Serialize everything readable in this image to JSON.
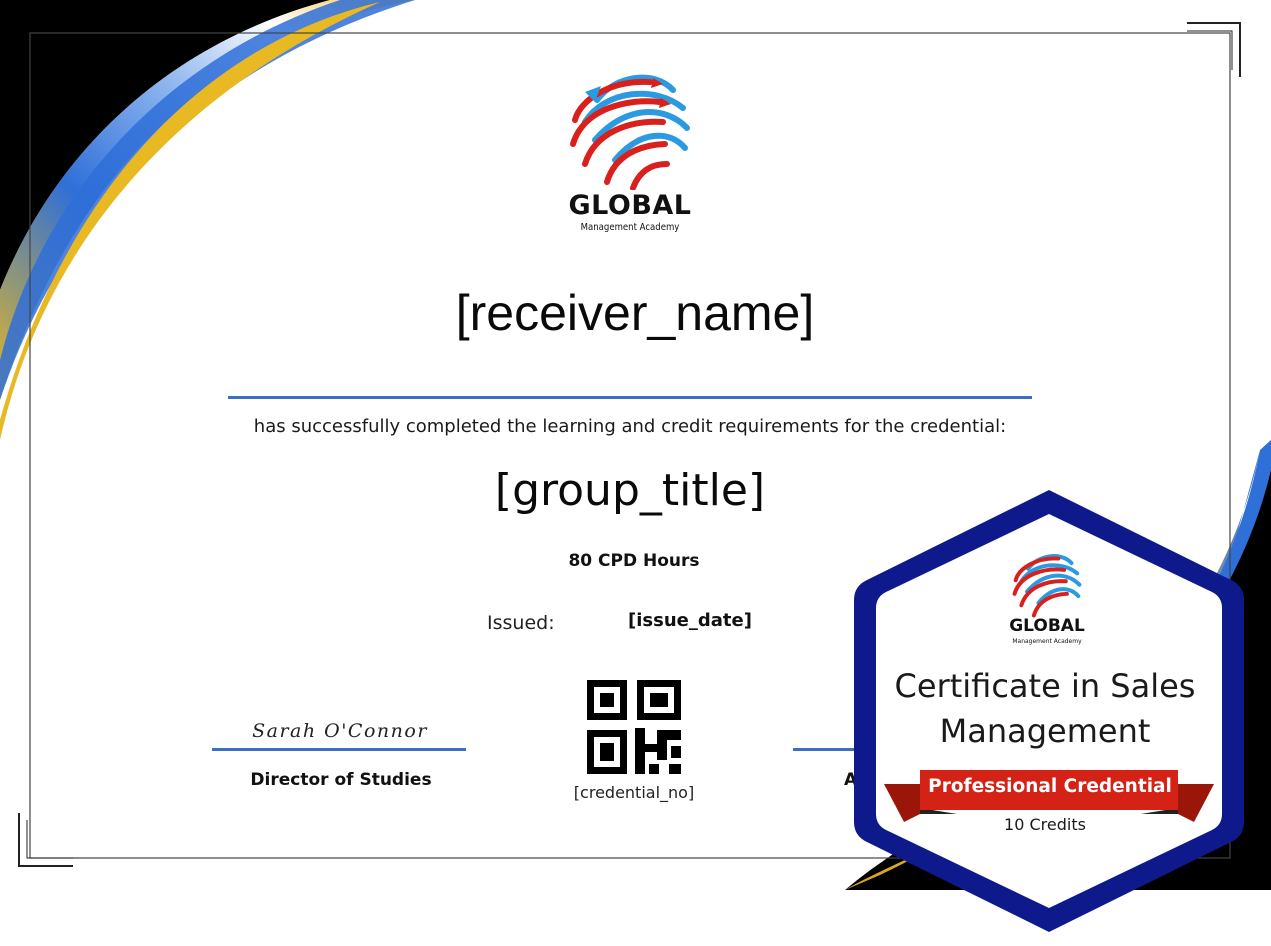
{
  "certificate": {
    "receiver_name": "[receiver_name]",
    "completion_text": "has successfully completed the learning and credit requirements for the credential:",
    "group_title": "[group_title]",
    "cpd_hours": "80 CPD Hours",
    "issued_label": "Issued:",
    "issue_date": "[issue_date]",
    "credential_no": "[credential_no]"
  },
  "logo": {
    "name": "GLOBAL",
    "tagline": "Management Academy",
    "icon": "globe-arrows-icon"
  },
  "signatories": {
    "left": {
      "signature": "Sarah O'Connor",
      "title": "Director of Studies"
    },
    "right": {
      "title_visible": "A"
    }
  },
  "badge": {
    "logo_name": "GLOBAL",
    "logo_tagline": "Management Academy",
    "title": "Certificate in Sales Management",
    "ribbon_label": "Professional Credential",
    "credits": "10 Credits"
  },
  "colors": {
    "accent_blue": "#3d6fc4",
    "swoosh_gold": "#e8b923",
    "swoosh_blue": "#2f6fd8",
    "badge_navy": "#0e1a8c",
    "ribbon_red": "#d42316",
    "logo_red": "#d9201c",
    "logo_blue": "#2a9be0"
  }
}
